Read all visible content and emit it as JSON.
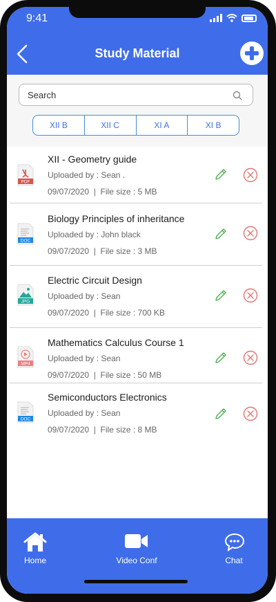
{
  "status": {
    "time": "9:41"
  },
  "header": {
    "title": "Study Material"
  },
  "search": {
    "placeholder": "Search"
  },
  "segments": [
    "XII B",
    "XII C",
    "XI A",
    "XI B"
  ],
  "materials": [
    {
      "title": "XII - Geometry guide",
      "uploaded_by": "Uploaded by : Sean .",
      "date": "09/07/2020",
      "size": "File size : 5 MB",
      "file_type": "PDF",
      "icon": "pdf-file-icon",
      "icon_color": "#d9534f"
    },
    {
      "title": "Biology Principles of inheritance",
      "uploaded_by": "Uploaded by : John black",
      "date": "09/07/2020",
      "size": "File size : 3 MB",
      "file_type": "DOC",
      "icon": "doc-file-icon",
      "icon_color": "#1e88e5"
    },
    {
      "title": "Electric Circuit Design",
      "uploaded_by": "Uploaded by : Sean",
      "date": "09/07/2020",
      "size": "File size : 700 KB",
      "file_type": "JPG",
      "icon": "jpg-file-icon",
      "icon_color": "#26a69a"
    },
    {
      "title": "Mathematics Calculus Course 1",
      "uploaded_by": "Uploaded by : Sean",
      "date": "09/07/2020",
      "size": "File size : 50 MB",
      "file_type": "MP4",
      "icon": "mp4-file-icon",
      "icon_color": "#ef7f7f"
    },
    {
      "title": "Semiconductors Electronics",
      "uploaded_by": "Uploaded by : Sean",
      "date": "09/07/2020",
      "size": "File size : 8 MB",
      "file_type": "DOC",
      "icon": "doc-file-icon",
      "icon_color": "#1e88e5"
    }
  ],
  "meta_separator": "|",
  "bottom_nav": [
    {
      "label": "Home",
      "icon": "home-icon"
    },
    {
      "label": "Video Conf",
      "icon": "video-camera-icon"
    },
    {
      "label": "Chat",
      "icon": "chat-bubble-icon"
    }
  ],
  "colors": {
    "primary": "#3f6de9",
    "edit": "#4caf50",
    "delete": "#e57373"
  }
}
